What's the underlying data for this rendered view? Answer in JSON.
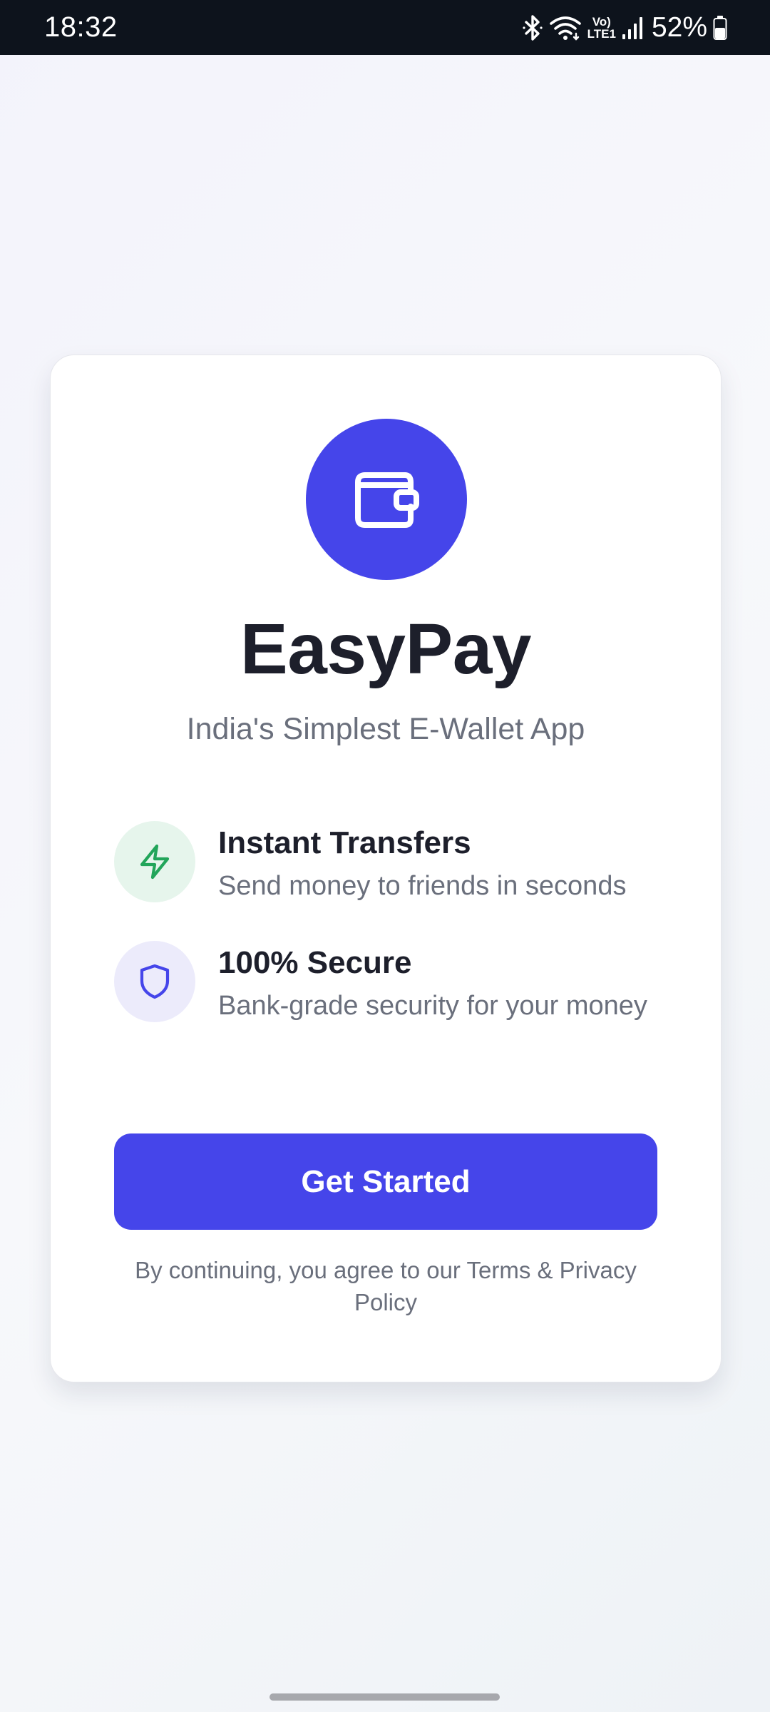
{
  "status_bar": {
    "time": "18:32",
    "battery": "52%",
    "network_label_top": "Vo)",
    "network_label_bottom": "LTE1",
    "icons": [
      "bluetooth-icon",
      "wifi-icon",
      "volte-icon",
      "signal-icon",
      "battery-icon"
    ]
  },
  "app": {
    "name": "EasyPay",
    "tagline": "India's Simplest E-Wallet App",
    "logo_icon": "wallet-icon"
  },
  "features": [
    {
      "title": "Instant Transfers",
      "description": "Send money to friends in seconds",
      "icon": "lightning-icon"
    },
    {
      "title": "100% Secure",
      "description": "Bank-grade security for your money",
      "icon": "shield-icon"
    }
  ],
  "cta": {
    "label": "Get Started"
  },
  "terms_text": "By continuing, you agree to our Terms & Privacy Policy",
  "colors": {
    "primary": "#4545ea",
    "text_dark": "#1d1f2b",
    "text_muted": "#6a6f7c",
    "green_accent": "#22a55a",
    "green_bg": "#e6f5ec",
    "purple_bg": "#ecebfb",
    "status_bar_bg": "#0d131c"
  }
}
